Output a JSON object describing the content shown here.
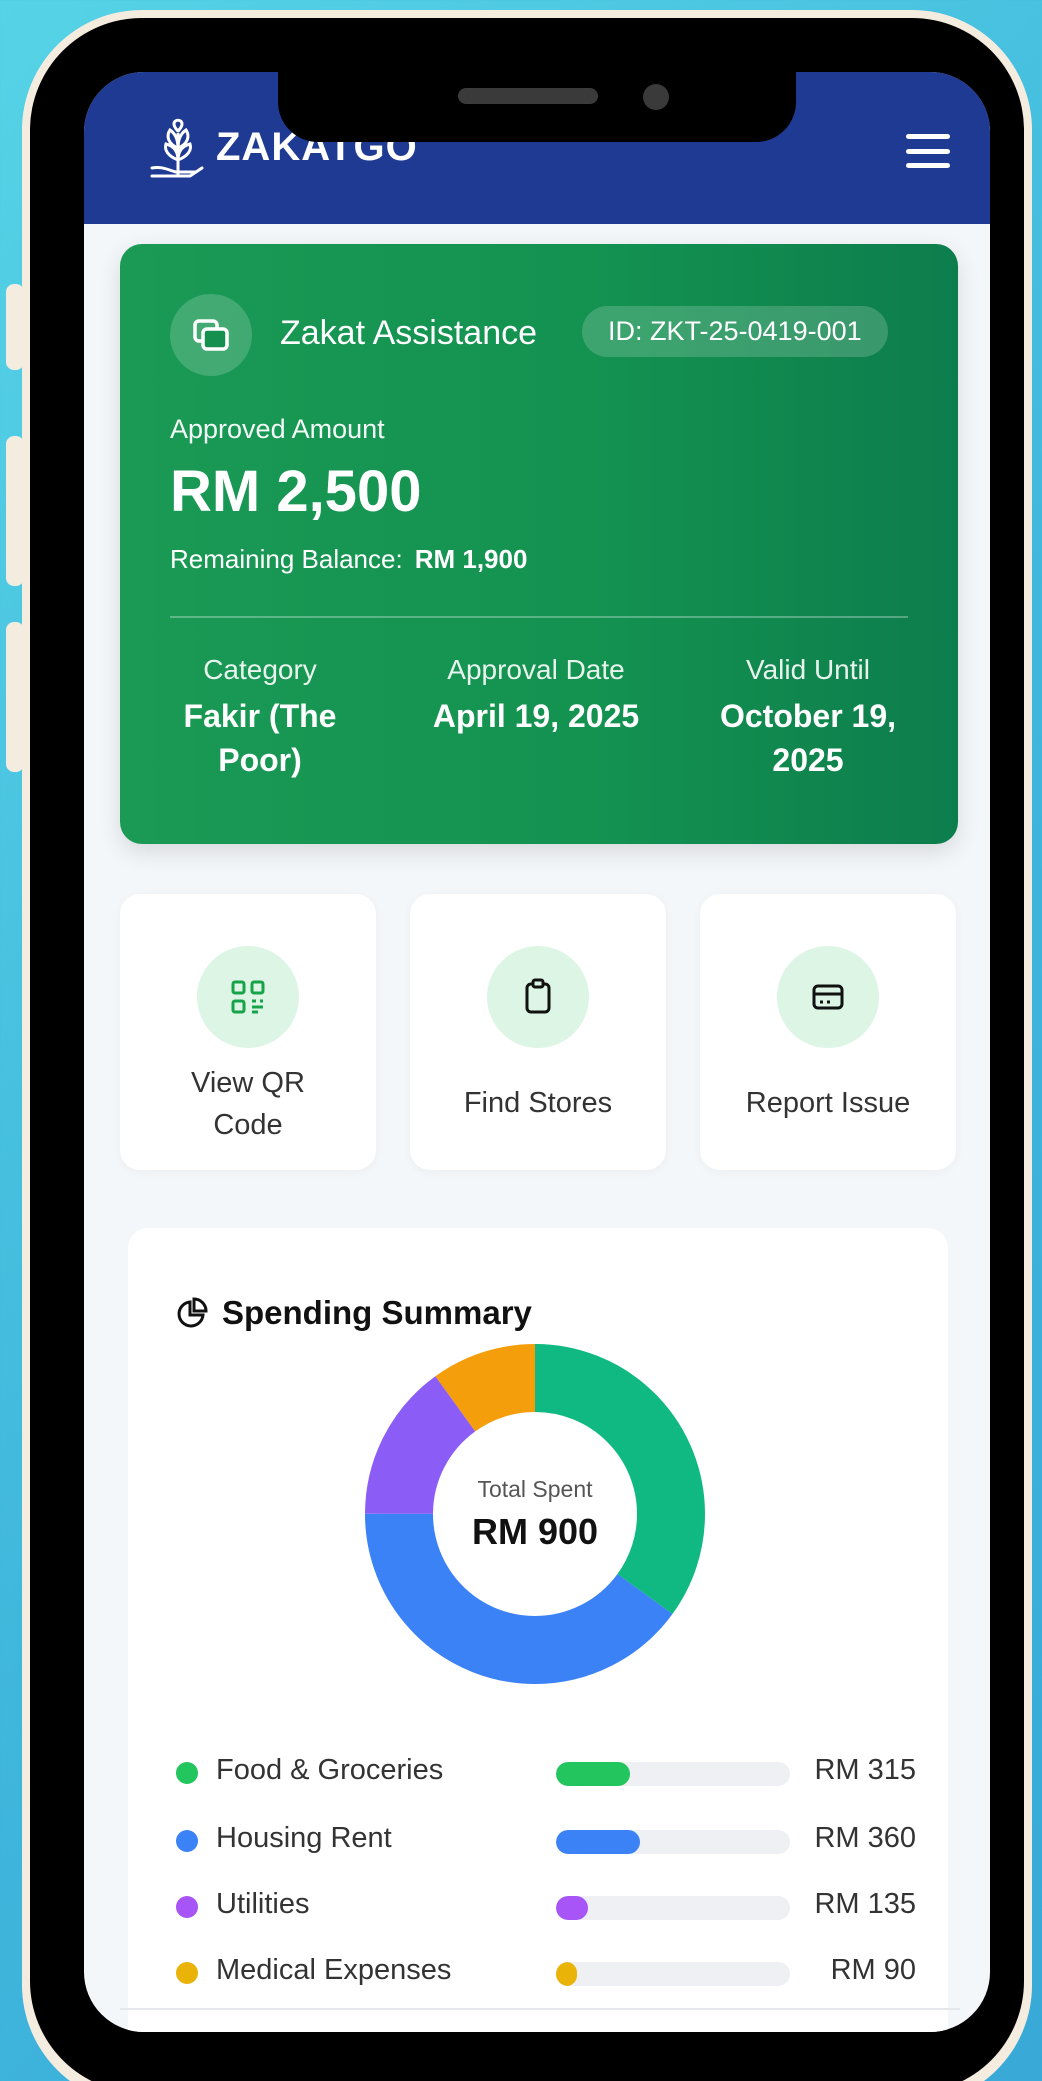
{
  "app": {
    "brand": "ZAKATGO"
  },
  "assistance": {
    "title": "Zakat Assistance",
    "id": "ID: ZKT-25-0419-001",
    "approved_label": "Approved Amount",
    "approved_amount": "RM 2,500",
    "remaining_label": "Remaining Balance:",
    "remaining_value": "RM 1,900",
    "category_label": "Category",
    "category_line1": "Fakir (The",
    "category_line2": "Poor)",
    "approval_label": "Approval Date",
    "approval_value": "April 19, 2025",
    "valid_label": "Valid Until",
    "valid_line1": "October 19,",
    "valid_line2": "2025"
  },
  "actions": {
    "qr_line1": "View QR",
    "qr_line2": "Code",
    "stores": "Find Stores",
    "report": "Report Issue"
  },
  "summary": {
    "title": "Spending Summary",
    "total_label": "Total Spent",
    "total_value": "RM 900"
  },
  "chart_data": {
    "type": "pie",
    "categories": [
      "Food & Groceries",
      "Housing Rent",
      "Utilities",
      "Medical Expenses"
    ],
    "values": [
      315,
      360,
      135,
      90
    ],
    "value_labels": [
      "RM 315",
      "RM 360",
      "RM 135",
      "RM 90"
    ],
    "colors": [
      "#10b981",
      "#3b82f6",
      "#8b5cf6",
      "#f59e0b"
    ],
    "bar_colors": [
      "#22c55e",
      "#3b82f6",
      "#a855f7",
      "#eab308"
    ],
    "max": 1000
  }
}
